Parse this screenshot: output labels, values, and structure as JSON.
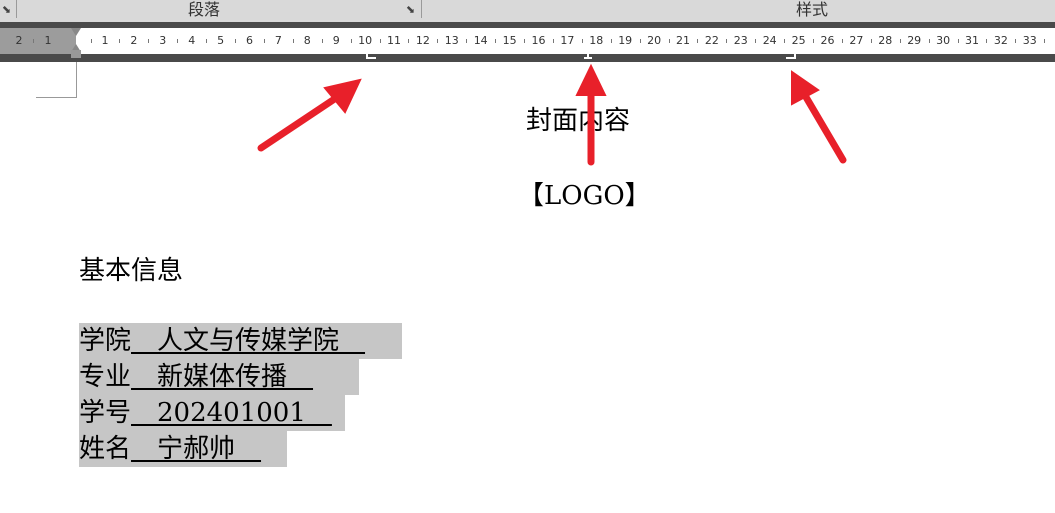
{
  "ribbon": {
    "paragraph_group": "段落",
    "styles_group": "样式"
  },
  "ruler": {
    "left_labels": [
      "2",
      "1"
    ],
    "labels": [
      "1",
      "2",
      "3",
      "4",
      "5",
      "6",
      "7",
      "8",
      "9",
      "10",
      "11",
      "12",
      "13",
      "14",
      "15",
      "16",
      "17",
      "18",
      "19",
      "20",
      "21",
      "22",
      "23",
      "24",
      "25",
      "26",
      "27",
      "28",
      "29",
      "30",
      "31",
      "32",
      "33",
      "3"
    ]
  },
  "document": {
    "cover_title": "封面内容",
    "logo": "【LOGO】",
    "section_heading": "基本信息",
    "fields": [
      {
        "label": "学院",
        "value": "　人文与传媒学院　"
      },
      {
        "label": "专业",
        "value": "　新媒体传播　"
      },
      {
        "label": "学号",
        "value": "　202401001　"
      },
      {
        "label": "姓名",
        "value": "　宁郝帅　"
      }
    ]
  },
  "colors": {
    "arrow": "#e8202a",
    "highlight": "#c6c6c6",
    "ruler_bg": "#4a4a4a"
  }
}
